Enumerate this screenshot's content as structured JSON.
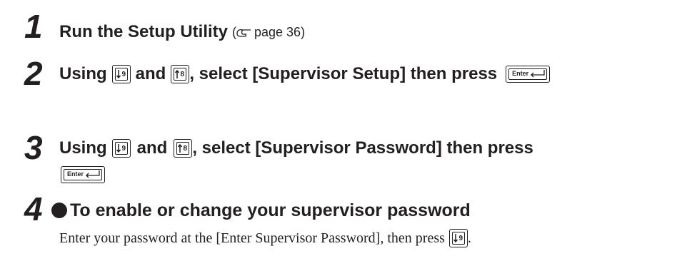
{
  "steps": [
    {
      "number": "1",
      "text": "Run the Setup Utility",
      "ref_open": "(",
      "ref_icon": "hand-pointer-icon",
      "ref_text": "page 36)"
    },
    {
      "number": "2",
      "text_a": "Using",
      "text_b": "and",
      "text_c": ", select [Supervisor Setup] then press"
    },
    {
      "number": "3",
      "text_a": "Using",
      "text_b": "and",
      "text_c": ", select [Supervisor Password] then press"
    },
    {
      "number": "4",
      "heading": "To enable or change your supervisor password",
      "description": "Enter your password at the [Enter Supervisor Password], then press",
      "description_end": "."
    }
  ],
  "keys": {
    "down": "down-arrow-9-key-icon",
    "up": "up-arrow-8-key-icon",
    "enter_label": "Enter"
  }
}
